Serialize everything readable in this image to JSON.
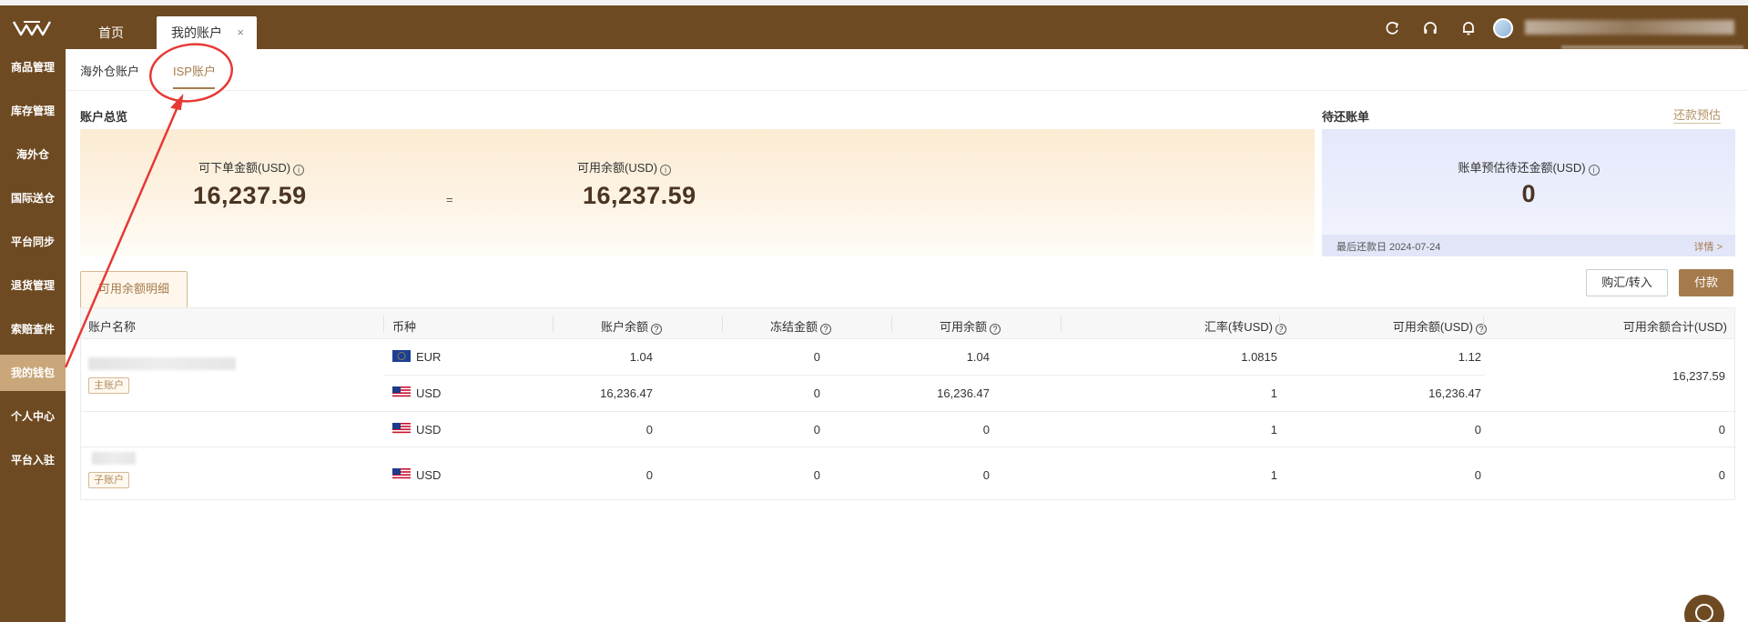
{
  "topbar": {
    "tabs": [
      {
        "label": "首页"
      },
      {
        "label": "我的账户",
        "close": "×"
      }
    ],
    "icons": [
      "refresh-icon",
      "headset-icon",
      "bell-icon"
    ]
  },
  "sidebar": {
    "items": [
      {
        "label": "商品管理"
      },
      {
        "label": "库存管理"
      },
      {
        "label": "海外仓"
      },
      {
        "label": "国际送仓"
      },
      {
        "label": "平台同步"
      },
      {
        "label": "退货管理"
      },
      {
        "label": "索赔查件"
      },
      {
        "label": "我的钱包"
      },
      {
        "label": "个人中心"
      },
      {
        "label": "平台入驻"
      }
    ],
    "active_index": 7
  },
  "subtabs": [
    {
      "label": "海外仓账户"
    },
    {
      "label": "ISP账户"
    }
  ],
  "overview": {
    "title": "账户总览",
    "orderable_label": "可下单金额(USD)",
    "orderable_value": "16,237.59",
    "equals": "=",
    "available_label": "可用余额(USD)",
    "available_value": "16,237.59"
  },
  "bill": {
    "title": "待还账单",
    "repay_link": "还款预估",
    "estimate_label": "账单预估待还金额(USD)",
    "estimate_value": "0",
    "last_date": "最后还款日 2024-07-24",
    "detail_link": "详情 >"
  },
  "detail": {
    "tab_label": "可用余额明细",
    "exchange_button": "购汇/转入",
    "pay_button": "付款"
  },
  "table": {
    "headers": [
      "账户名称",
      "币种",
      "账户余额",
      "冻结金额",
      "可用余额",
      "汇率(转USD)",
      "可用余额(USD)",
      "可用余额合计(USD)"
    ],
    "rows": [
      {
        "badge": "主账户",
        "currency": "EUR",
        "balance": "1.04",
        "frozen": "0",
        "available": "1.04",
        "rate": "1.0815",
        "available_usd": "1.12"
      },
      {
        "currency": "USD",
        "balance": "16,236.47",
        "frozen": "0",
        "available": "16,236.47",
        "rate": "1",
        "available_usd": "16,236.47"
      },
      {
        "currency": "USD",
        "balance": "0",
        "frozen": "0",
        "available": "0",
        "rate": "1",
        "available_usd": "0"
      },
      {
        "badge": "子账户",
        "currency": "USD",
        "balance": "0",
        "frozen": "0",
        "available": "0",
        "rate": "1",
        "available_usd": "0"
      }
    ],
    "totals": [
      "16,237.59",
      "0",
      "0"
    ]
  },
  "colors": {
    "brand": "#6e4a22",
    "accent": "#a57b4d",
    "sidebar_active": "#c9a77a",
    "annotation": "#e53935"
  }
}
